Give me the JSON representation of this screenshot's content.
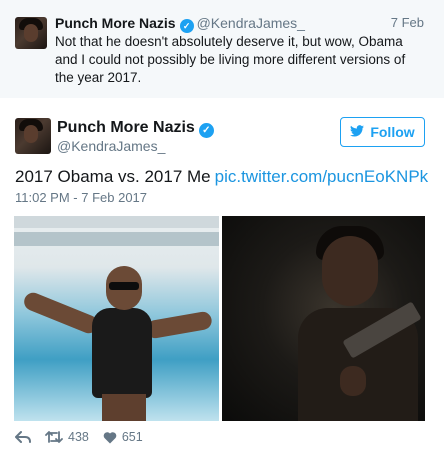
{
  "parent_tweet": {
    "name": "Punch More Nazis",
    "handle": "@KendraJames_",
    "date": "7 Feb",
    "text": "Not that he doesn't absolutely deserve it, but wow, Obama and I could not possibly be living more different versions of the year 2017."
  },
  "main_tweet": {
    "name": "Punch More Nazis",
    "handle": "@KendraJames_",
    "follow_label": "Follow",
    "text": "2017 Obama vs. 2017 Me",
    "link": "pic.twitter.com/pucnEoKNPk",
    "timestamp": "11:02 PM - 7 Feb 2017"
  },
  "actions": {
    "retweets": "438",
    "likes": "651"
  },
  "icons": {
    "verified": "verified-badge-icon",
    "follow": "twitter-bird-icon",
    "reply": "reply-icon",
    "retweet": "retweet-icon",
    "like": "heart-icon"
  },
  "colors": {
    "accent": "#1da1f2",
    "link": "#1b95e0",
    "muted": "#657786",
    "text": "#14171a",
    "parent_bg": "#f5f8fa"
  }
}
